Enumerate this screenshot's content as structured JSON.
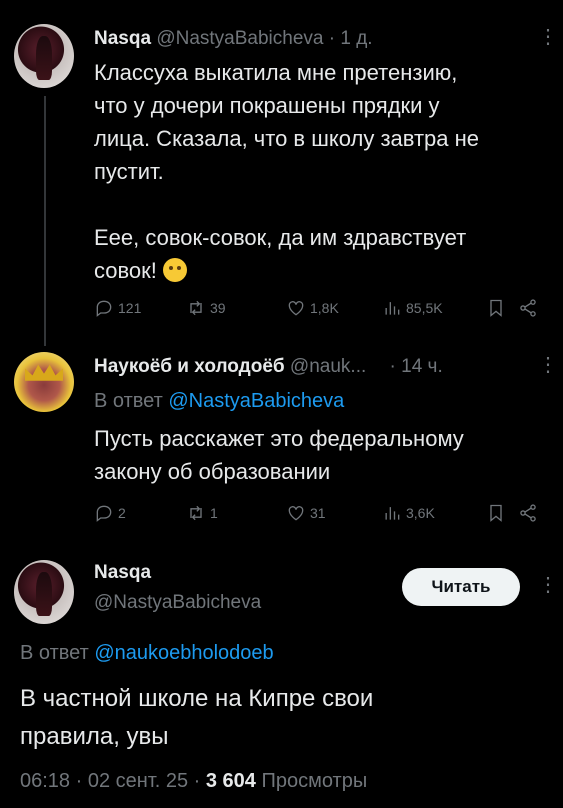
{
  "tweet1": {
    "name": "Nasqa",
    "handle": "@NastyaBabicheva",
    "time": "· 1 д.",
    "text_lines": [
      "Классуха выкатила мне претензию,",
      "что у дочери покрашены прядки у",
      "лица. Сказала, что в школу завтра не",
      "пустит.",
      "",
      "Еее, совок-совок, да им здравствует",
      "совок!"
    ],
    "stats": {
      "replies": "121",
      "retweets": "39",
      "likes": "1,8K",
      "views": "85,5K"
    }
  },
  "tweet2": {
    "name": "Наукоёб и холодоёб",
    "handle": "@nauk...",
    "time": "· 14 ч.",
    "reply_prefix": "В ответ",
    "reply_to": "@NastyaBabicheva",
    "text_lines": [
      "Пусть расскажет это федеральному",
      "закону об образовании"
    ],
    "stats": {
      "replies": "2",
      "retweets": "1",
      "likes": "31",
      "views": "3,6K"
    }
  },
  "tweet3": {
    "name": "Nasqa",
    "handle": "@NastyaBabicheva",
    "read_button": "Читать",
    "reply_prefix": "В ответ",
    "reply_to": "@naukoebholodoeb",
    "text_lines": [
      "В частной школе на Кипре свои",
      "правила, увы"
    ],
    "time": "06:18 · 02 сент. 25 ·",
    "views_count": "3 604",
    "views_label": "Просмотры"
  }
}
